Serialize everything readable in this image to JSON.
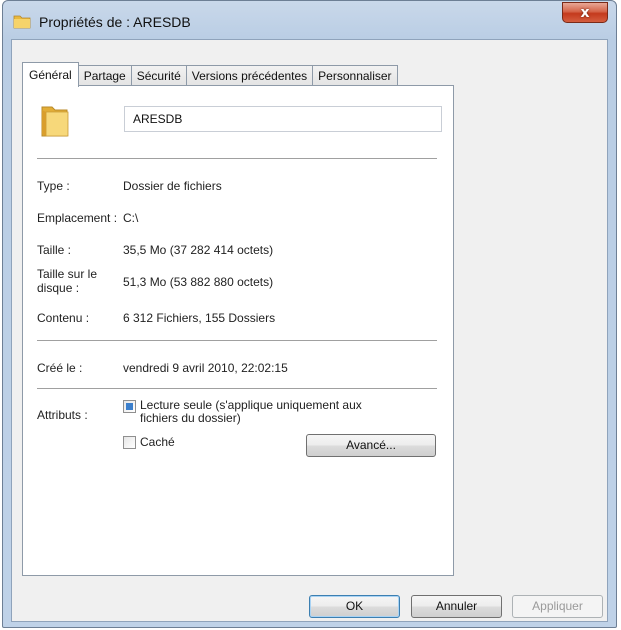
{
  "window": {
    "title": "Propriétés de : ARESDB",
    "close_glyph": "x"
  },
  "tabs": [
    {
      "label": "Général"
    },
    {
      "label": "Partage"
    },
    {
      "label": "Sécurité"
    },
    {
      "label": "Versions précédentes"
    },
    {
      "label": "Personnaliser"
    }
  ],
  "general": {
    "folder_name": "ARESDB",
    "type_label": "Type :",
    "type_value": "Dossier de fichiers",
    "location_label": "Emplacement :",
    "location_value": "C:\\",
    "size_label": "Taille :",
    "size_value": "35,5 Mo (37 282 414 octets)",
    "disk_size_label_1": "Taille sur le",
    "disk_size_label_2": "disque :",
    "disk_size_value": "51,3 Mo (53 882 880 octets)",
    "contents_label": "Contenu :",
    "contents_value": "6 312 Fichiers, 155 Dossiers",
    "created_label": "Créé le :",
    "created_value": "vendredi 9 avril 2010, 22:02:15",
    "attributes_label": "Attributs :",
    "readonly_line1": "Lecture seule (s'applique uniquement aux",
    "readonly_line2": "fichiers du dossier)",
    "hidden_label": "Caché",
    "advanced_button": "Avancé..."
  },
  "footer": {
    "ok": "OK",
    "cancel": "Annuler",
    "apply": "Appliquer"
  },
  "colors": {
    "folder_yellow": "#f0c64c",
    "checkbox_fill": "#3b7fcc",
    "close_red": "#c43a1d"
  }
}
